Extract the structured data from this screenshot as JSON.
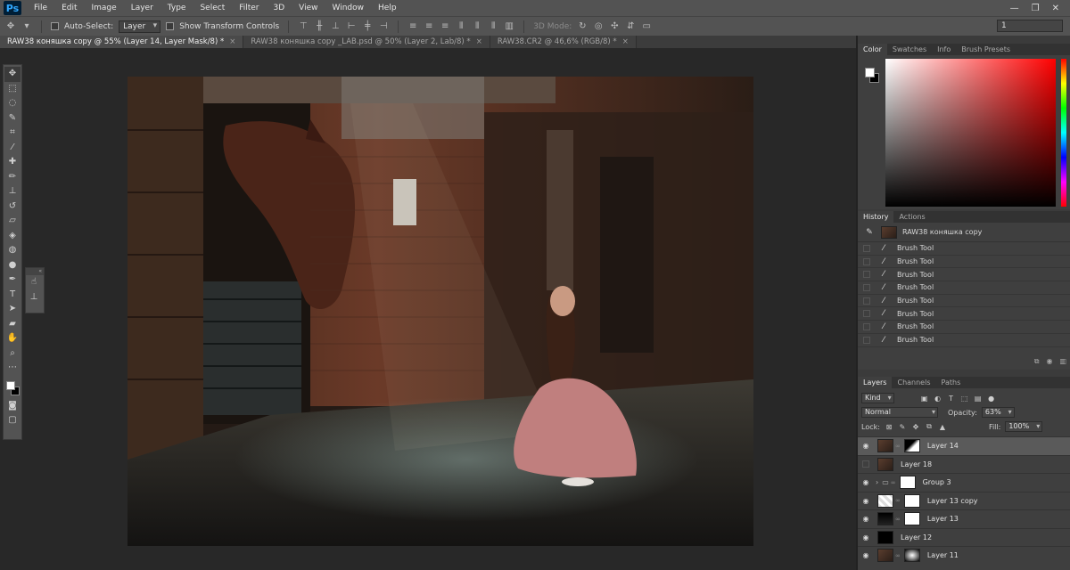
{
  "app": {
    "logo": "Ps"
  },
  "menu": [
    "File",
    "Edit",
    "Image",
    "Layer",
    "Type",
    "Select",
    "Filter",
    "3D",
    "View",
    "Window",
    "Help"
  ],
  "window_controls": {
    "minimize": "—",
    "restore": "❐",
    "close": "✕"
  },
  "options_bar": {
    "auto_select_label": "Auto-Select:",
    "auto_select_value": "Layer",
    "show_transform_label": "Show Transform Controls",
    "mode_3d_label": "3D Mode:",
    "right_field_value": "1"
  },
  "tabs": [
    {
      "label": "RAW38 коняшка copy @ 55% (Layer 14, Layer Mask/8) *",
      "close": "×"
    },
    {
      "label": "RAW38 коняшка copy _LAB.psd @ 50% (Layer 2, Lab/8) *",
      "close": "×"
    },
    {
      "label": "RAW38.CR2 @ 46,6% (RGB/8) *",
      "close": "×"
    }
  ],
  "colors": {
    "foreground": "#ffffff",
    "background": "#000000",
    "accent": "#31a8ff"
  },
  "panels": {
    "color_tabs": [
      "Color",
      "Swatches",
      "Info",
      "Brush Presets"
    ],
    "history_tabs": [
      "History",
      "Actions"
    ],
    "history_snapshot": "RAW38 коняшка copy",
    "history_items": [
      "Brush Tool",
      "Brush Tool",
      "Brush Tool",
      "Brush Tool",
      "Brush Tool",
      "Brush Tool",
      "Brush Tool",
      "Brush Tool"
    ],
    "layers_tabs": [
      "Layers",
      "Channels",
      "Paths"
    ]
  },
  "layers": {
    "filter_kind": "Kind",
    "blend_mode": "Normal",
    "opacity_label": "Opacity:",
    "opacity_value": "63%",
    "lock_label": "Lock:",
    "fill_label": "Fill:",
    "fill_value": "100%",
    "items": [
      {
        "name": "Layer 14"
      },
      {
        "name": "Layer 18"
      },
      {
        "name": "Group 3"
      },
      {
        "name": "Layer 13 copy"
      },
      {
        "name": "Layer 13"
      },
      {
        "name": "Layer 12"
      },
      {
        "name": "Layer 11"
      }
    ]
  }
}
